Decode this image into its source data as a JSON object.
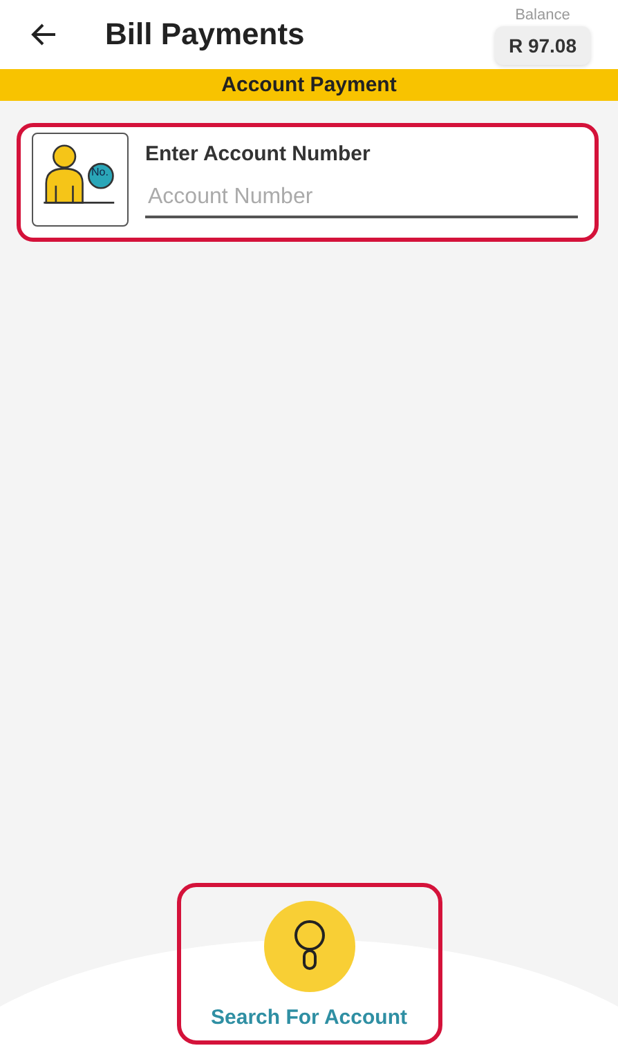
{
  "header": {
    "title": "Bill Payments",
    "balance_label": "Balance",
    "balance": "R 97.08"
  },
  "banner": "Account Payment",
  "account_card": {
    "highlighted": true,
    "label": "Enter Account Number",
    "badge": "No.",
    "placeholder": "Account Number"
  },
  "search_button": {
    "highlighted": true,
    "label": "Search For Account"
  }
}
